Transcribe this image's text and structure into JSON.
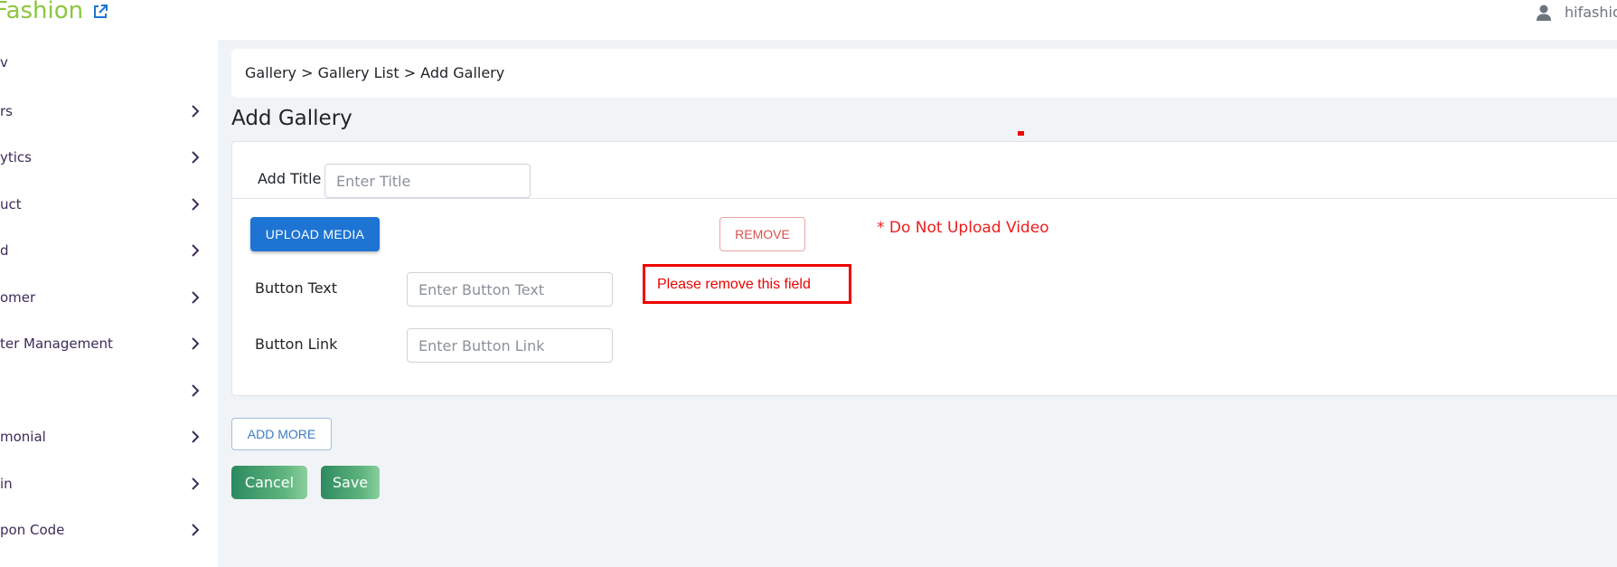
{
  "header": {
    "brand": "Fashion",
    "external_link_icon": "external-link-icon",
    "user_icon": "user-icon",
    "user_name": "hifashio"
  },
  "sidebar": {
    "items": [
      {
        "label": "v",
        "has_chevron": false
      },
      {
        "label": "rs",
        "has_chevron": true
      },
      {
        "label": "ytics",
        "has_chevron": true
      },
      {
        "label": "uct",
        "has_chevron": true
      },
      {
        "label": "d",
        "has_chevron": true
      },
      {
        "label": "omer",
        "has_chevron": true
      },
      {
        "label": "ter Management",
        "has_chevron": true
      },
      {
        "label": "",
        "has_chevron": true
      },
      {
        "label": "monial",
        "has_chevron": true
      },
      {
        "label": "in",
        "has_chevron": true
      },
      {
        "label": "pon Code",
        "has_chevron": true
      }
    ]
  },
  "breadcrumb": "Gallery > Gallery List > Add Gallery",
  "page_title": "Add Gallery",
  "form": {
    "title_label": "Add Title",
    "title_placeholder": "Enter Title",
    "upload_button": "UPLOAD MEDIA",
    "remove_button": "REMOVE",
    "warning": "* Do Not Upload Video",
    "button_text_label": "Button Text",
    "button_text_placeholder": "Enter Button Text",
    "button_link_label": "Button Link",
    "button_link_placeholder": "Enter Button Link"
  },
  "annotation": {
    "text": "Please remove this field",
    "color": "#ee0000"
  },
  "actions": {
    "add_more": "ADD MORE",
    "cancel": "Cancel",
    "save": "Save"
  },
  "colors": {
    "brand": "#8cc63f",
    "primary": "#1e74d2",
    "danger": "#d9534f",
    "success_gradient_start": "#2c8a60",
    "background": "#f1f4f6"
  }
}
